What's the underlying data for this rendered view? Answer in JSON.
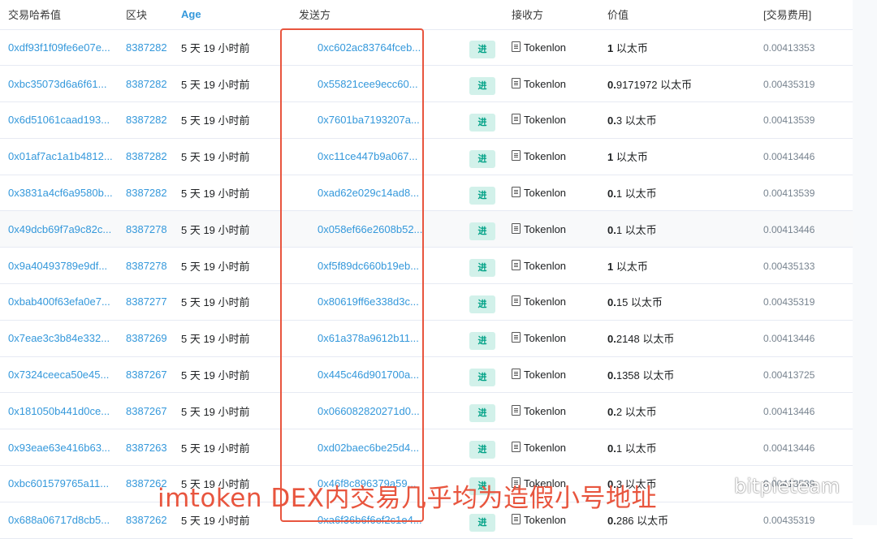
{
  "headers": {
    "hash": "交易哈希值",
    "block": "区块",
    "age": "Age",
    "from": "发送方",
    "to": "接收方",
    "value": "价值",
    "fee": "[交易费用]"
  },
  "rows": [
    {
      "hash": "0xdf93f1f09fe6e07e...",
      "block": "8387282",
      "age": "5 天 19 小时前",
      "from": "0xc602ac83764fceb...",
      "dir": "进",
      "to": "Tokenlon",
      "value": "1 以太币",
      "fee": "0.00413353"
    },
    {
      "hash": "0xbc35073d6a6f61...",
      "block": "8387282",
      "age": "5 天 19 小时前",
      "from": "0x55821cee9ecc60...",
      "dir": "进",
      "to": "Tokenlon",
      "value": "0.9171972 以太币",
      "fee": "0.00435319"
    },
    {
      "hash": "0x6d51061caad193...",
      "block": "8387282",
      "age": "5 天 19 小时前",
      "from": "0x7601ba7193207a...",
      "dir": "进",
      "to": "Tokenlon",
      "value": "0.3 以太币",
      "fee": "0.00413539"
    },
    {
      "hash": "0x01af7ac1a1b4812...",
      "block": "8387282",
      "age": "5 天 19 小时前",
      "from": "0xc11ce447b9a067...",
      "dir": "进",
      "to": "Tokenlon",
      "value": "1 以太币",
      "fee": "0.00413446"
    },
    {
      "hash": "0x3831a4cf6a9580b...",
      "block": "8387282",
      "age": "5 天 19 小时前",
      "from": "0xad62e029c14ad8...",
      "dir": "进",
      "to": "Tokenlon",
      "value": "0.1 以太币",
      "fee": "0.00413539"
    },
    {
      "hash": "0x49dcb69f7a9c82c...",
      "block": "8387278",
      "age": "5 天 19 小时前",
      "from": "0x058ef66e2608b52...",
      "dir": "进",
      "to": "Tokenlon",
      "value": "0.1 以太币",
      "fee": "0.00413446"
    },
    {
      "hash": "0x9a40493789e9df...",
      "block": "8387278",
      "age": "5 天 19 小时前",
      "from": "0xf5f89dc660b19eb...",
      "dir": "进",
      "to": "Tokenlon",
      "value": "1 以太币",
      "fee": "0.00435133"
    },
    {
      "hash": "0xbab400f63efa0e7...",
      "block": "8387277",
      "age": "5 天 19 小时前",
      "from": "0x80619ff6e338d3c...",
      "dir": "进",
      "to": "Tokenlon",
      "value": "0.15 以太币",
      "fee": "0.00435319"
    },
    {
      "hash": "0x7eae3c3b84e332...",
      "block": "8387269",
      "age": "5 天 19 小时前",
      "from": "0x61a378a9612b11...",
      "dir": "进",
      "to": "Tokenlon",
      "value": "0.2148 以太币",
      "fee": "0.00413446"
    },
    {
      "hash": "0x7324ceeca50e45...",
      "block": "8387267",
      "age": "5 天 19 小时前",
      "from": "0x445c46d901700a...",
      "dir": "进",
      "to": "Tokenlon",
      "value": "0.1358 以太币",
      "fee": "0.00413725"
    },
    {
      "hash": "0x181050b441d0ce...",
      "block": "8387267",
      "age": "5 天 19 小时前",
      "from": "0x066082820271d0...",
      "dir": "进",
      "to": "Tokenlon",
      "value": "0.2 以太币",
      "fee": "0.00413446"
    },
    {
      "hash": "0x93eae63e416b63...",
      "block": "8387263",
      "age": "5 天 19 小时前",
      "from": "0xd02baec6be25d4...",
      "dir": "进",
      "to": "Tokenlon",
      "value": "0.1 以太币",
      "fee": "0.00413446"
    },
    {
      "hash": "0xbc601579765a11...",
      "block": "8387262",
      "age": "5 天 19 小时前",
      "from": "0x46f8c896379a59...",
      "dir": "进",
      "to": "Tokenlon",
      "value": "0.3 以太币",
      "fee": "0.00413539"
    },
    {
      "hash": "0x688a06717d8cb5...",
      "block": "8387262",
      "age": "5 天 19 小时前",
      "from": "0xa6f36b6f6ef2c1e4...",
      "dir": "进",
      "to": "Tokenlon",
      "value": "0.286 以太币",
      "fee": "0.00435319"
    }
  ],
  "highlighted_row": 5,
  "overlay_caption": "imtoken DEX内交易几乎均为造假小号地址",
  "watermark_text": "bitpieteam",
  "colors": {
    "link": "#3498db",
    "in_badge_bg": "#d2f1ea",
    "in_badge_text": "#00a186",
    "annotation": "#e8553e"
  }
}
